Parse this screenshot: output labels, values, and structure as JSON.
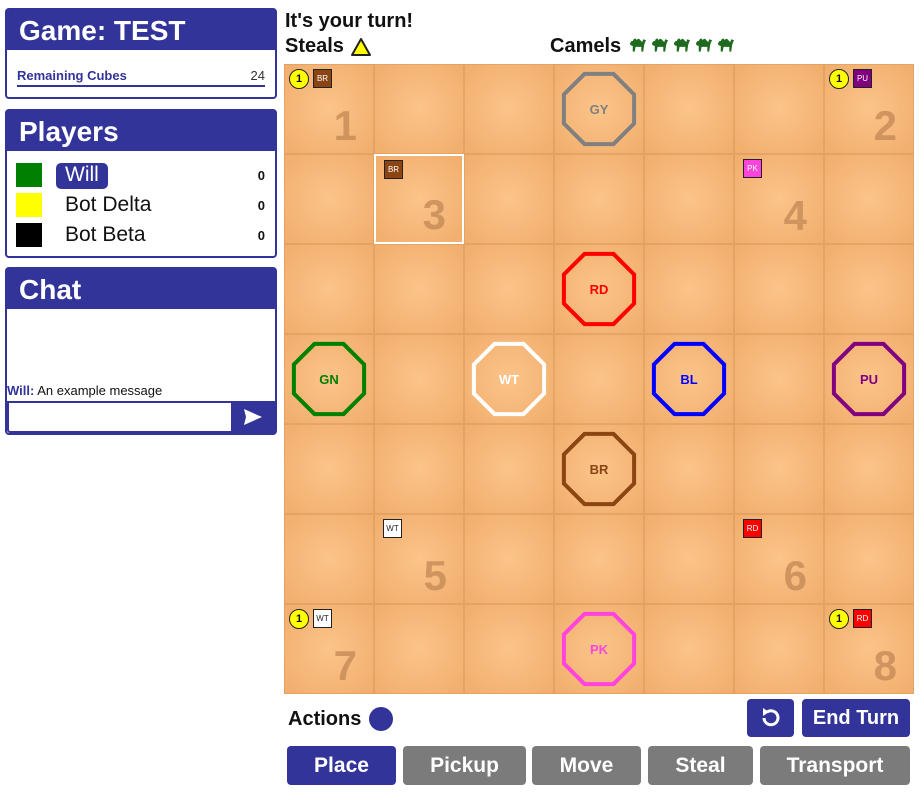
{
  "game": {
    "title": "Game: TEST",
    "remaining_label": "Remaining Cubes",
    "remaining_value": "24"
  },
  "players": {
    "title": "Players",
    "list": [
      {
        "name": "Will",
        "score": "0",
        "color": "#008000",
        "active": true
      },
      {
        "name": "Bot Delta",
        "score": "0",
        "color": "#ffff00",
        "active": false
      },
      {
        "name": "Bot Beta",
        "score": "0",
        "color": "#000000",
        "active": false
      }
    ]
  },
  "chat": {
    "title": "Chat",
    "messages": [
      {
        "author": "Will:",
        "text": "An example message"
      }
    ],
    "input_value": "",
    "send_icon": "send-icon"
  },
  "status": {
    "turn": "It's your turn!",
    "steals_label": "Steals",
    "camels_label": "Camels",
    "camel_count": 5,
    "steal_icon": "warning-triangle-icon",
    "camel_icon": "camel-icon"
  },
  "board": {
    "grid_size": 7,
    "numbered_cells": [
      {
        "number": "1",
        "row": 0,
        "col": 0,
        "badge": "1",
        "tag": "BR"
      },
      {
        "number": "2",
        "row": 0,
        "col": 6,
        "badge": "1",
        "tag": "PU"
      },
      {
        "number": "3",
        "row": 1,
        "col": 1,
        "badge": null,
        "tag": "BR",
        "selected": true
      },
      {
        "number": "4",
        "row": 1,
        "col": 5,
        "badge": null,
        "tag": "PK"
      },
      {
        "number": "5",
        "row": 5,
        "col": 1,
        "badge": null,
        "tag": "WT"
      },
      {
        "number": "6",
        "row": 5,
        "col": 5,
        "badge": null,
        "tag": "RD"
      },
      {
        "number": "7",
        "row": 6,
        "col": 0,
        "badge": "1",
        "tag": "WT"
      },
      {
        "number": "8",
        "row": 6,
        "col": 6,
        "badge": "1",
        "tag": "RD"
      }
    ],
    "octagons": [
      {
        "label": "GY",
        "row": 0,
        "col": 3,
        "color": "#808080"
      },
      {
        "label": "RD",
        "row": 2,
        "col": 3,
        "color": "#ff0000"
      },
      {
        "label": "GN",
        "row": 3,
        "col": 0,
        "color": "#008000"
      },
      {
        "label": "WT",
        "row": 3,
        "col": 2,
        "color": "#ffffff"
      },
      {
        "label": "BL",
        "row": 3,
        "col": 4,
        "color": "#0000ff"
      },
      {
        "label": "PU",
        "row": 3,
        "col": 6,
        "color": "#800080"
      },
      {
        "label": "BR",
        "row": 4,
        "col": 3,
        "color": "#8b4513"
      },
      {
        "label": "PK",
        "row": 6,
        "col": 3,
        "color": "#ff44dd"
      }
    ]
  },
  "tag_colors": {
    "BR": "#8b4513",
    "PU": "#800080",
    "PK": "#ff44dd",
    "WT": "#ffffff",
    "RD": "#ff0000"
  },
  "controls": {
    "actions_label": "Actions",
    "undo_icon": "undo-icon",
    "end_turn": "End Turn",
    "buttons": [
      {
        "label": "Place",
        "active": true
      },
      {
        "label": "Pickup",
        "active": false
      },
      {
        "label": "Move",
        "active": false
      },
      {
        "label": "Steal",
        "active": false
      },
      {
        "label": "Transport",
        "active": false
      }
    ]
  },
  "accent_color": "#33349a"
}
